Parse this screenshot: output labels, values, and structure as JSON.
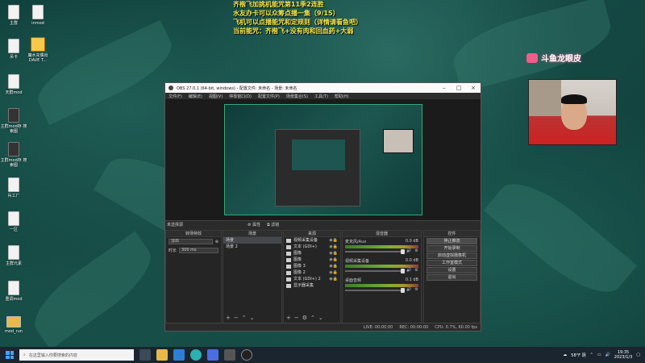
{
  "desktop": {
    "icons": [
      {
        "label": "主群"
      },
      {
        "label": "inmod"
      },
      {
        "label": "吊卡"
      },
      {
        "label": "魔水充偶出 DAVE T..."
      },
      {
        "label": "天群mod"
      },
      {
        "label": "主群mod存 搜索图"
      },
      {
        "label": "主群mod存 搜索图"
      },
      {
        "label": "兵工厂"
      },
      {
        "label": "一区"
      },
      {
        "label": "主群元素"
      },
      {
        "label": "重调mod"
      },
      {
        "label": "mod_run"
      }
    ]
  },
  "overlay": {
    "lines": [
      "齐楷飞加挑机能咒第11季2连胜",
      "水友办卡可以众筹点播一集（9/15）",
      "飞机可以点播能咒和定规则（详情请看鱼吧）",
      "当前能咒：齐楷飞+没有肉和回血药+大弱"
    ]
  },
  "douyu": {
    "brand": "斗鱼龙眼皮"
  },
  "obs": {
    "title": "OBS 27.0.1 (64-bit, windows) - 配置文件: 未命名 - 场景: 未命名",
    "menu": [
      "文件(F)",
      "编辑(E)",
      "视图(V)",
      "停靠窗口(D)",
      "配置文件(P)",
      "场景集合(S)",
      "工具(T)",
      "帮助(H)"
    ],
    "no_source": "未选择源",
    "properties_btn": "属性",
    "filters_btn": "滤镜",
    "docks": {
      "transitions": {
        "title": "转场特效",
        "type": "淡出",
        "duration_label": "时长",
        "duration": "300 ms"
      },
      "scenes": {
        "title": "场景",
        "items": [
          "场景",
          "场景 2"
        ]
      },
      "sources": {
        "title": "来源",
        "items": [
          "视频采集设备",
          "文本 (GDI+)",
          "图像",
          "图像",
          "图像 3",
          "图像 2",
          "文本 (GDI+) 2",
          "显示器采集"
        ]
      },
      "mixer": {
        "title": "混音器",
        "channels": [
          {
            "name": "麦克风/Aux",
            "db": "0.0 dB"
          },
          {
            "name": "视频采集设备",
            "db": "0.0 dB"
          },
          {
            "name": "桌面音频",
            "db": "0.1 dB"
          }
        ]
      },
      "controls": {
        "title": "控件",
        "buttons": [
          "停止推流",
          "开始录制",
          "启动虚拟摄像机",
          "工作室模式",
          "设置",
          "退出"
        ]
      }
    },
    "status": {
      "live": "LIVE: 00:00:00",
      "rec": "REC: 00:00:00",
      "cpu": "CPU: 0.7%, 60.00 fps"
    }
  },
  "taskbar": {
    "search_placeholder": "在这里输入你要搜索的内容",
    "weather": "58°F 阴",
    "time": "19:35",
    "date": "2023/1/3"
  }
}
